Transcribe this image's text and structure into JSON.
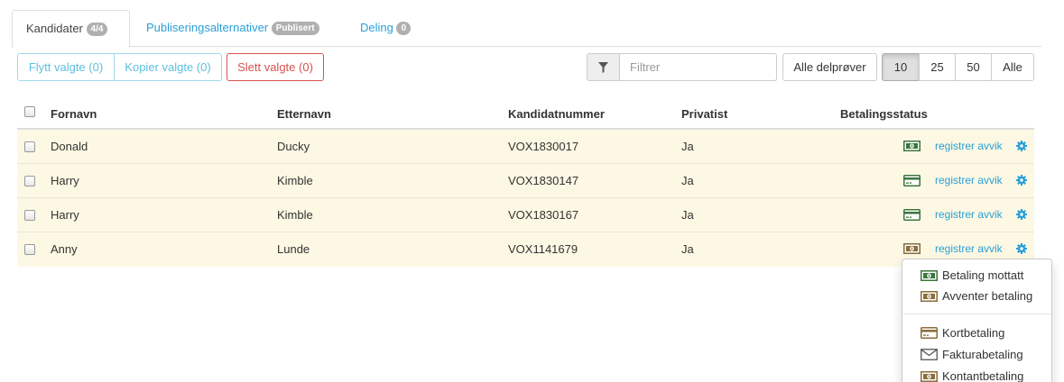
{
  "tabs": [
    {
      "label": "Kandidater",
      "badge": "4/4"
    },
    {
      "label": "Publiseringsalternativer",
      "badge": "Publisert"
    },
    {
      "label": "Deling",
      "badge": "0"
    }
  ],
  "toolbar": {
    "move_label": "Flytt valgte (0)",
    "copy_label": "Kopier valgte (0)",
    "delete_label": "Slett valgte (0)",
    "filter_placeholder": "Filtrer",
    "subtests_label": "Alle delprøver",
    "page_sizes": [
      "10",
      "25",
      "50",
      "Alle"
    ],
    "selected_page_size": "10"
  },
  "table": {
    "columns": [
      "Fornavn",
      "Etternavn",
      "Kandidatnummer",
      "Privatist",
      "Betalingsstatus"
    ],
    "rows": [
      {
        "first": "Donald",
        "last": "Ducky",
        "number": "VOX1830017",
        "private": "Ja",
        "payment_icon": "money-icon-green",
        "action": "registrer avvik"
      },
      {
        "first": "Harry",
        "last": "Kimble",
        "number": "VOX1830147",
        "private": "Ja",
        "payment_icon": "card-icon-green",
        "action": "registrer avvik"
      },
      {
        "first": "Harry",
        "last": "Kimble",
        "number": "VOX1830167",
        "private": "Ja",
        "payment_icon": "card-icon-green",
        "action": "registrer avvik"
      },
      {
        "first": "Anny",
        "last": "Lunde",
        "number": "VOX1141679",
        "private": "Ja",
        "payment_icon": "money-icon-brown",
        "action": "registrer avvik"
      }
    ]
  },
  "dropdown": {
    "items": [
      {
        "label": "Betaling mottatt",
        "icon": "money-icon-green"
      },
      {
        "label": "Avventer betaling",
        "icon": "money-icon-brown"
      },
      {
        "label": "Kortbetaling",
        "icon": "card-icon-brown"
      },
      {
        "label": "Fakturabetaling",
        "icon": "envelope-icon"
      },
      {
        "label": "Kontantbetaling",
        "icon": "money-icon-brown"
      }
    ]
  },
  "colors": {
    "link": "#2a9fd6",
    "row_highlight": "#fcf8e3",
    "paid_green": "#3c763d",
    "pending_brown": "#8a6d3b",
    "danger": "#d9534f",
    "info": "#5bc0de"
  }
}
